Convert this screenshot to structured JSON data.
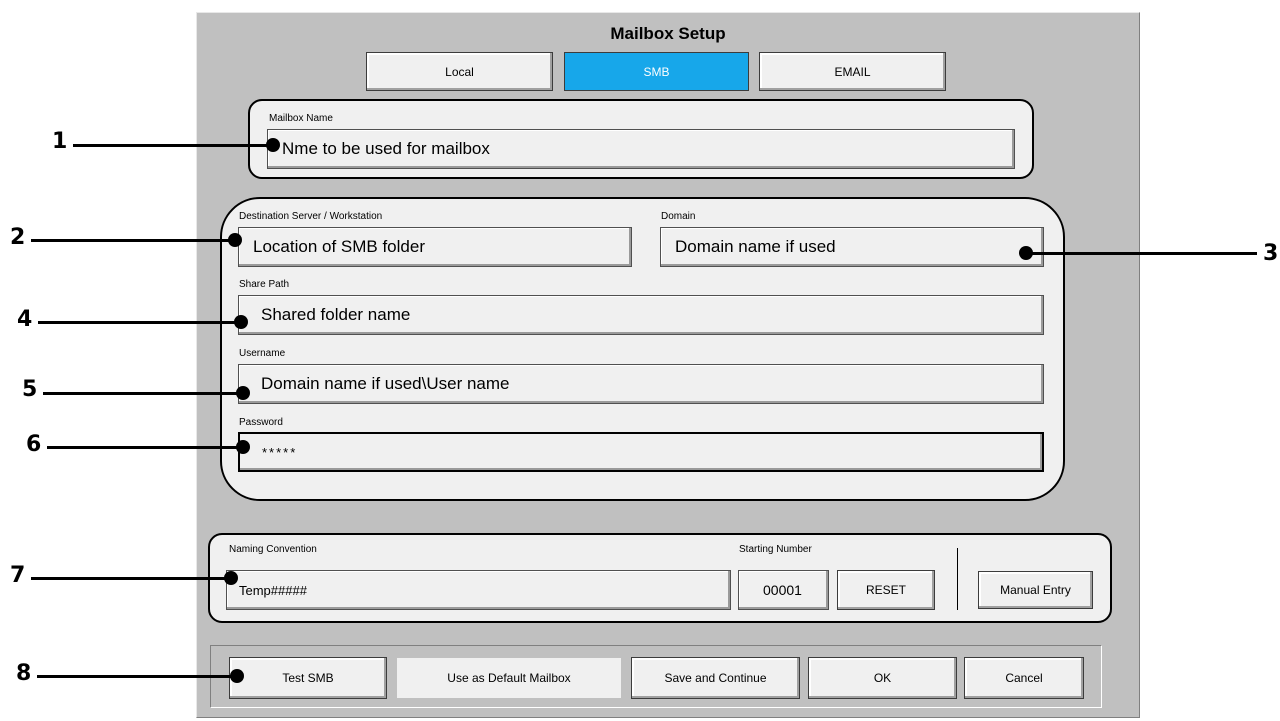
{
  "dialog": {
    "title": "Mailbox Setup"
  },
  "tabs": [
    {
      "label": "Local"
    },
    {
      "label": "SMB"
    },
    {
      "label": "EMAIL"
    }
  ],
  "mailbox": {
    "label": "Mailbox Name",
    "value": "Nme to be used for mailbox"
  },
  "smb": {
    "server_label": "Destination Server / Workstation",
    "server_value": "Location of SMB folder",
    "domain_label": "Domain",
    "domain_value": "Domain name if used",
    "share_label": "Share Path",
    "share_value": "Shared folder name",
    "username_label": "Username",
    "username_value": "Domain name if used\\User name",
    "password_label": "Password",
    "password_value": "*****"
  },
  "naming": {
    "label": "Naming Convention",
    "value": "Temp#####",
    "start_label": "Starting Number",
    "start_value": "00001",
    "reset_label": "RESET",
    "manual_label": "Manual Entry"
  },
  "footer": {
    "test": "Test SMB",
    "default": "Use as Default Mailbox",
    "save": "Save and Continue",
    "ok": "OK",
    "cancel": "Cancel"
  },
  "callouts": [
    "1",
    "2",
    "3",
    "4",
    "5",
    "6",
    "7",
    "8"
  ],
  "colors": {
    "active_tab": "#17a7ea",
    "dialog_bg": "#c0c0c0",
    "panel_bg": "#f0f0f0"
  }
}
